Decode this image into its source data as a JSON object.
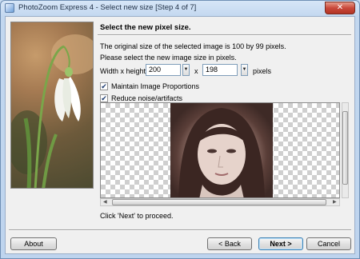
{
  "window": {
    "title": "PhotoZoom Express 4 - Select new size [Step 4 of 7]",
    "close_glyph": "✕"
  },
  "step": {
    "heading": "Select the new pixel size.",
    "original_info": "The original size of the selected image is 100 by 99 pixels.",
    "instruction": "Please select the new image size in pixels.",
    "size_label": "Width x height:",
    "width_value": "200",
    "height_value": "198",
    "times_sign": "x",
    "units": "pixels",
    "spin_up": "▲",
    "spin_down": "▼",
    "maintain_label": "Maintain Image Proportions",
    "maintain_checked": "✔",
    "reduce_label": "Reduce noise/artifacts",
    "reduce_checked": "✔",
    "proceed_text": "Click 'Next' to proceed."
  },
  "buttons": {
    "about": "About",
    "back": "< Back",
    "next": "Next >",
    "cancel": "Cancel"
  },
  "icons": {
    "app": "photozoom-app-icon",
    "close": "close-icon"
  }
}
